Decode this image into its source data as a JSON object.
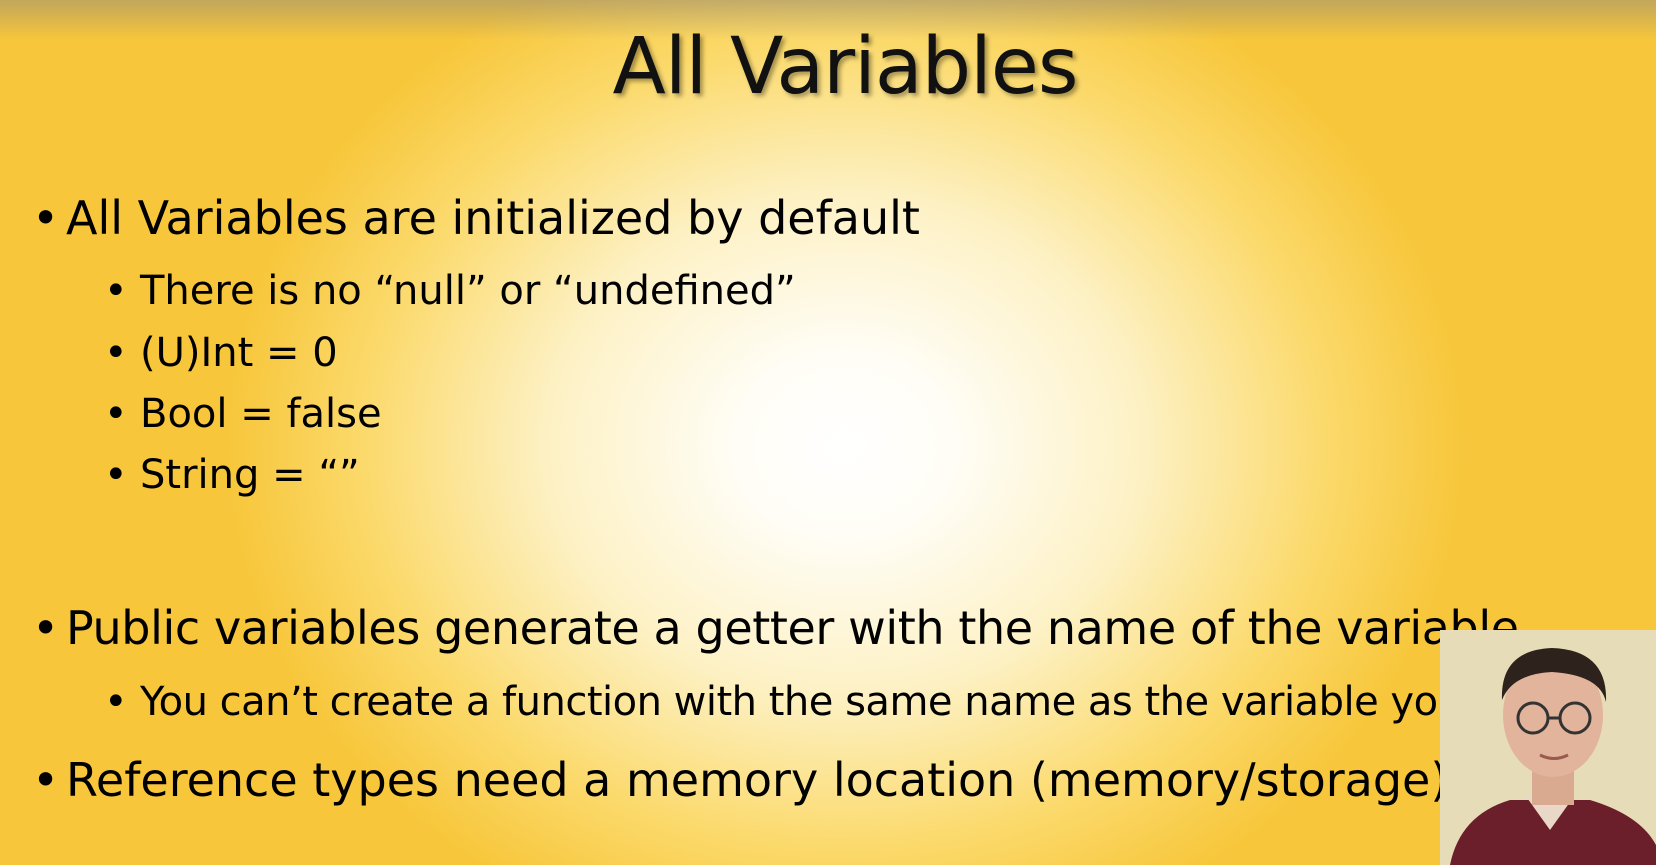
{
  "slide": {
    "title": "All Variables",
    "bullets": [
      {
        "text": "All Variables are initialized by default",
        "sub": [
          "There is no “null” or “undefined”",
          "(U)Int = 0",
          "Bool = false",
          "String = “”"
        ]
      },
      {
        "text": "Public variables generate a getter with the name of the variable",
        "sub": [
          "You can’t create a function with the same name as the variable yourself"
        ]
      },
      {
        "text": "Reference types need a memory location (memory/storage)",
        "sub": []
      }
    ],
    "bullet_glyph": "•"
  },
  "colors": {
    "background_center": "#ffffff",
    "background_edge": "#f7c63a",
    "text": "#000000"
  }
}
